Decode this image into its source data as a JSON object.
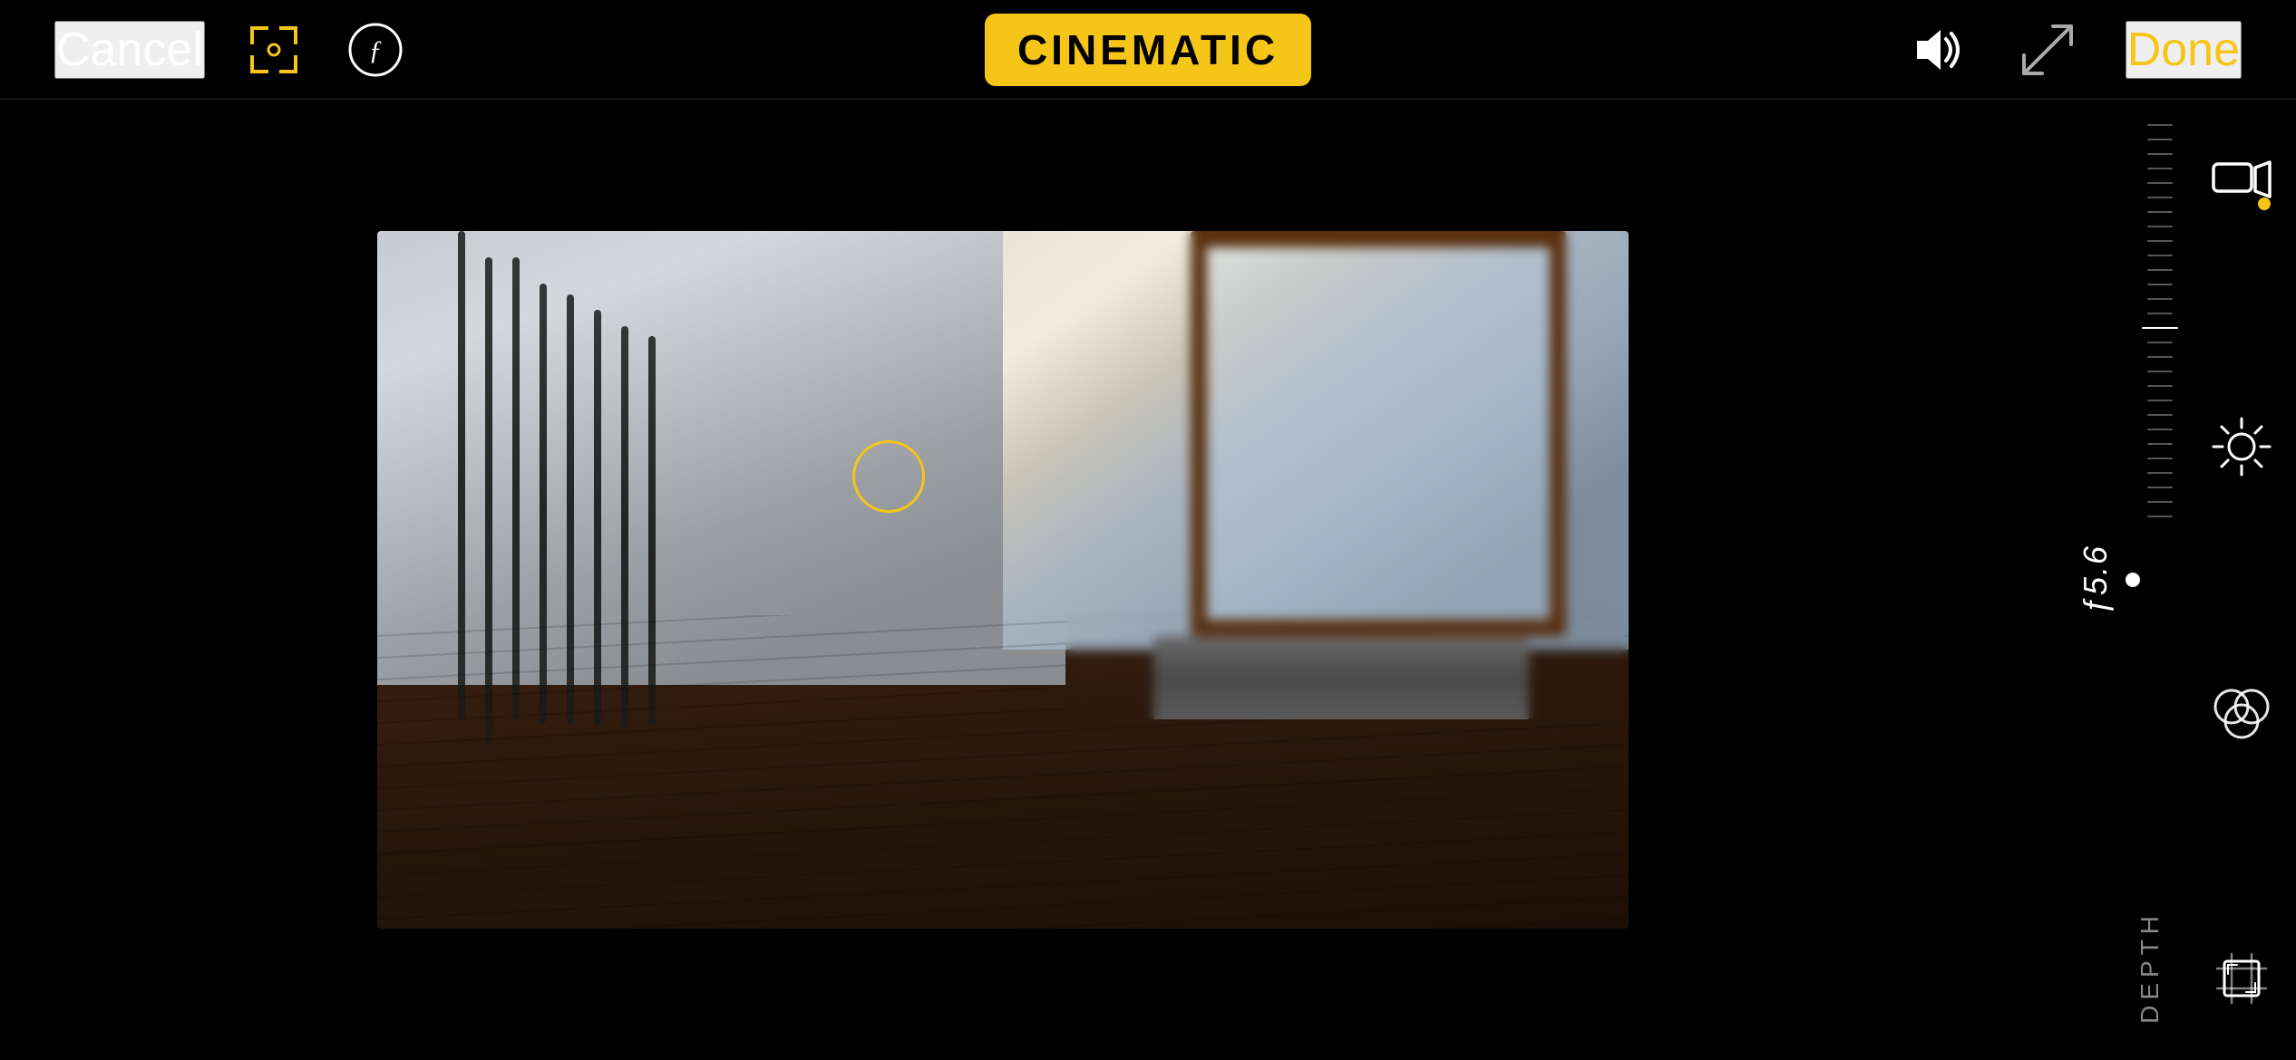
{
  "header": {
    "cancel_label": "Cancel",
    "done_label": "Done",
    "cinematic_label": "CINEMATIC",
    "mode_badge_color": "#f5c518"
  },
  "toolbar": {
    "focus_icon": "focus-square-icon",
    "aperture_icon": "aperture-f-icon",
    "sound_icon": "speaker-icon",
    "resize_icon": "resize-icon"
  },
  "right_panel": {
    "aperture_value": "ƒ5.6",
    "depth_label": "DEPTH",
    "icons": [
      {
        "name": "video-camera-icon",
        "has_dot": true
      },
      {
        "name": "adjustments-icon",
        "has_dot": false
      },
      {
        "name": "color-mix-icon",
        "has_dot": false
      },
      {
        "name": "crop-icon",
        "has_dot": false
      }
    ]
  },
  "slider": {
    "ticks": 28,
    "active_tick_index": 14
  }
}
